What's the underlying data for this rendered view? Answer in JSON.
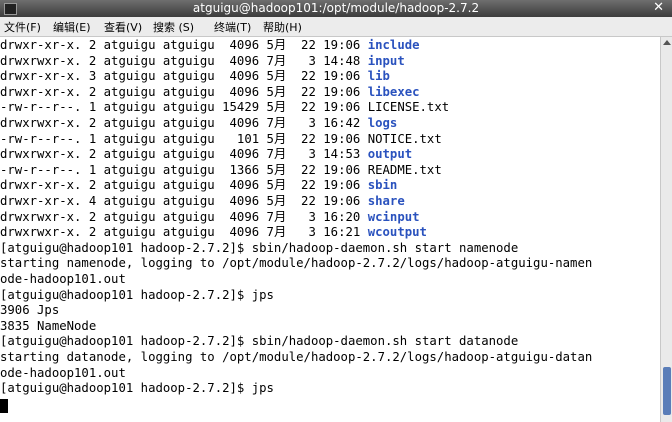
{
  "window": {
    "title": "atguigu@hadoop101:/opt/module/hadoop-2.7.2",
    "close_symbol": "✕"
  },
  "menu": [
    "文件(F)",
    "编辑(E)",
    "查看(V)",
    "搜索 (S)",
    "终端(T)",
    "帮助(H)"
  ],
  "listing": [
    {
      "perm": "drwxr-xr-x.",
      "links": "2",
      "owner": "atguigu",
      "group": "atguigu",
      "size": "4096",
      "month": "5月",
      "day": "22",
      "time": "19:06",
      "name": "include",
      "type": "dir"
    },
    {
      "perm": "drwxrwxr-x.",
      "links": "2",
      "owner": "atguigu",
      "group": "atguigu",
      "size": "4096",
      "month": "7月",
      "day": "3",
      "time": "14:48",
      "name": "input",
      "type": "dir"
    },
    {
      "perm": "drwxr-xr-x.",
      "links": "3",
      "owner": "atguigu",
      "group": "atguigu",
      "size": "4096",
      "month": "5月",
      "day": "22",
      "time": "19:06",
      "name": "lib",
      "type": "dir"
    },
    {
      "perm": "drwxr-xr-x.",
      "links": "2",
      "owner": "atguigu",
      "group": "atguigu",
      "size": "4096",
      "month": "5月",
      "day": "22",
      "time": "19:06",
      "name": "libexec",
      "type": "dir"
    },
    {
      "perm": "-rw-r--r--.",
      "links": "1",
      "owner": "atguigu",
      "group": "atguigu",
      "size": "15429",
      "month": "5月",
      "day": "22",
      "time": "19:06",
      "name": "LICENSE.txt",
      "type": "file"
    },
    {
      "perm": "drwxrwxr-x.",
      "links": "2",
      "owner": "atguigu",
      "group": "atguigu",
      "size": "4096",
      "month": "7月",
      "day": "3",
      "time": "16:42",
      "name": "logs",
      "type": "dir"
    },
    {
      "perm": "-rw-r--r--.",
      "links": "1",
      "owner": "atguigu",
      "group": "atguigu",
      "size": "101",
      "month": "5月",
      "day": "22",
      "time": "19:06",
      "name": "NOTICE.txt",
      "type": "file"
    },
    {
      "perm": "drwxrwxr-x.",
      "links": "2",
      "owner": "atguigu",
      "group": "atguigu",
      "size": "4096",
      "month": "7月",
      "day": "3",
      "time": "14:53",
      "name": "output",
      "type": "dir"
    },
    {
      "perm": "-rw-r--r--.",
      "links": "1",
      "owner": "atguigu",
      "group": "atguigu",
      "size": "1366",
      "month": "5月",
      "day": "22",
      "time": "19:06",
      "name": "README.txt",
      "type": "file"
    },
    {
      "perm": "drwxr-xr-x.",
      "links": "2",
      "owner": "atguigu",
      "group": "atguigu",
      "size": "4096",
      "month": "5月",
      "day": "22",
      "time": "19:06",
      "name": "sbin",
      "type": "dir"
    },
    {
      "perm": "drwxr-xr-x.",
      "links": "4",
      "owner": "atguigu",
      "group": "atguigu",
      "size": "4096",
      "month": "5月",
      "day": "22",
      "time": "19:06",
      "name": "share",
      "type": "dir"
    },
    {
      "perm": "drwxrwxr-x.",
      "links": "2",
      "owner": "atguigu",
      "group": "atguigu",
      "size": "4096",
      "month": "7月",
      "day": "3",
      "time": "16:20",
      "name": "wcinput",
      "type": "dir"
    },
    {
      "perm": "drwxrwxr-x.",
      "links": "2",
      "owner": "atguigu",
      "group": "atguigu",
      "size": "4096",
      "month": "7月",
      "day": "3",
      "time": "16:21",
      "name": "wcoutput",
      "type": "dir"
    }
  ],
  "output_lines": [
    "[atguigu@hadoop101 hadoop-2.7.2]$ sbin/hadoop-daemon.sh start namenode",
    "starting namenode, logging to /opt/module/hadoop-2.7.2/logs/hadoop-atguigu-namen",
    "ode-hadoop101.out",
    "[atguigu@hadoop101 hadoop-2.7.2]$ jps",
    "3906 Jps",
    "3835 NameNode",
    "[atguigu@hadoop101 hadoop-2.7.2]$ sbin/hadoop-daemon.sh start datanode",
    "starting datanode, logging to /opt/module/hadoop-2.7.2/logs/hadoop-atguigu-datan",
    "ode-hadoop101.out",
    "[atguigu@hadoop101 hadoop-2.7.2]$ jps"
  ],
  "colors": {
    "dir": "#2a52be",
    "text": "#000000",
    "background": "#ffffff"
  }
}
